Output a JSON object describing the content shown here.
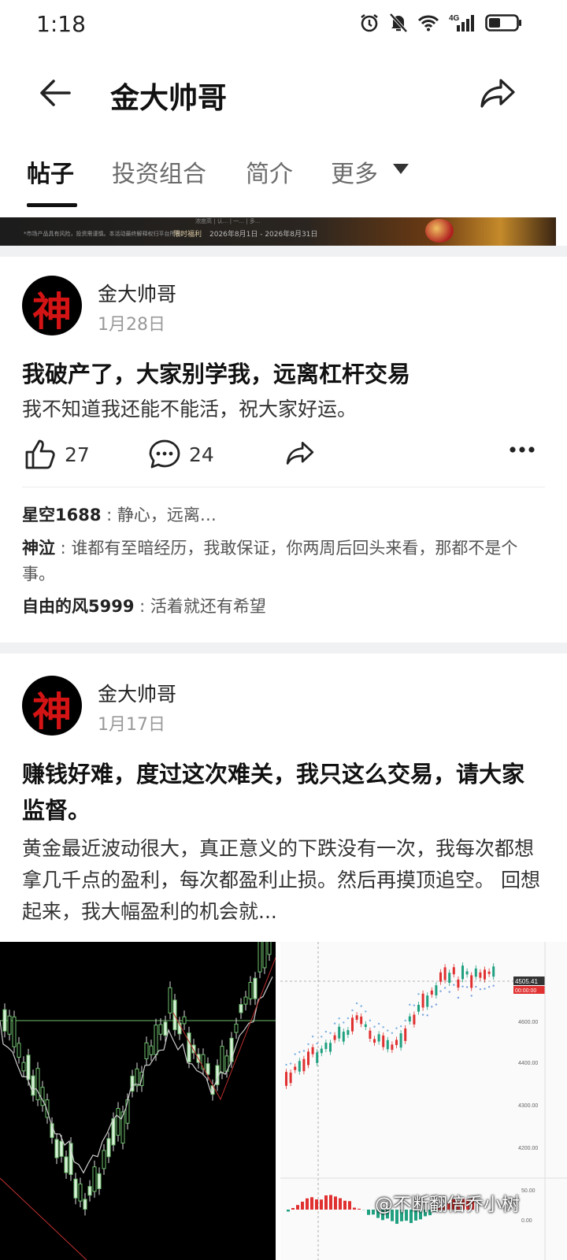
{
  "status_bar": {
    "time": "1:18",
    "network": "4G"
  },
  "header": {
    "title": "金大帅哥"
  },
  "tabs": [
    {
      "label": "帖子",
      "active": true
    },
    {
      "label": "投资组合",
      "active": false
    },
    {
      "label": "简介",
      "active": false
    },
    {
      "label": "更多",
      "active": false
    }
  ],
  "banner": {
    "line_top": "浓度高 | 认...  | 一...  | 多...",
    "text_small": "*市场产品具有风险，投资需谨慎。本活动最终解释权归平台所有。",
    "promo_tag": "限时福利",
    "promo_dates": "2026年8月1日 - 2026年8月31日"
  },
  "posts": [
    {
      "author": "金大帅哥",
      "avatar_char": "神",
      "date": "1月28日",
      "title": "我破产了，大家别学我，远离杠杆交易",
      "body": "我不知道我还能不能活，祝大家好运。",
      "likes": "27",
      "comments_count": "24",
      "comments": [
        {
          "user": "星空1688",
          "sep": " : ",
          "text": "静心，远离…"
        },
        {
          "user": "神泣",
          "sep": " : ",
          "text": "谁都有至暗经历，我敢保证，你两周后回头来看，那都不是个事。"
        },
        {
          "user": "自由的风5999",
          "sep": " : ",
          "text": "活着就还有希望"
        }
      ]
    },
    {
      "author": "金大帅哥",
      "avatar_char": "神",
      "date": "1月17日",
      "title": "赚钱好难，度过这次难关，我只这么交易，请大家监督。",
      "body": "黄金最近波动很大，真正意义的下跌没有一次，我每次都想拿几千点的盈利，每次都盈利止损。然后再摸顶追空。 回想起来，我大幅盈利的机会就..."
    }
  ],
  "chart_right": {
    "price_tag": "4505.41",
    "sub_tag": "00:00:00",
    "y_ticks": [
      "4600.00",
      "4400.00",
      "4300.00",
      "4200.00"
    ],
    "macd_ticks": [
      "50.00",
      "0.00"
    ]
  },
  "watermark": "@不断翻倍乔小树",
  "colors": {
    "up": "#e03030",
    "down": "#20a080",
    "accent": "#111111"
  }
}
